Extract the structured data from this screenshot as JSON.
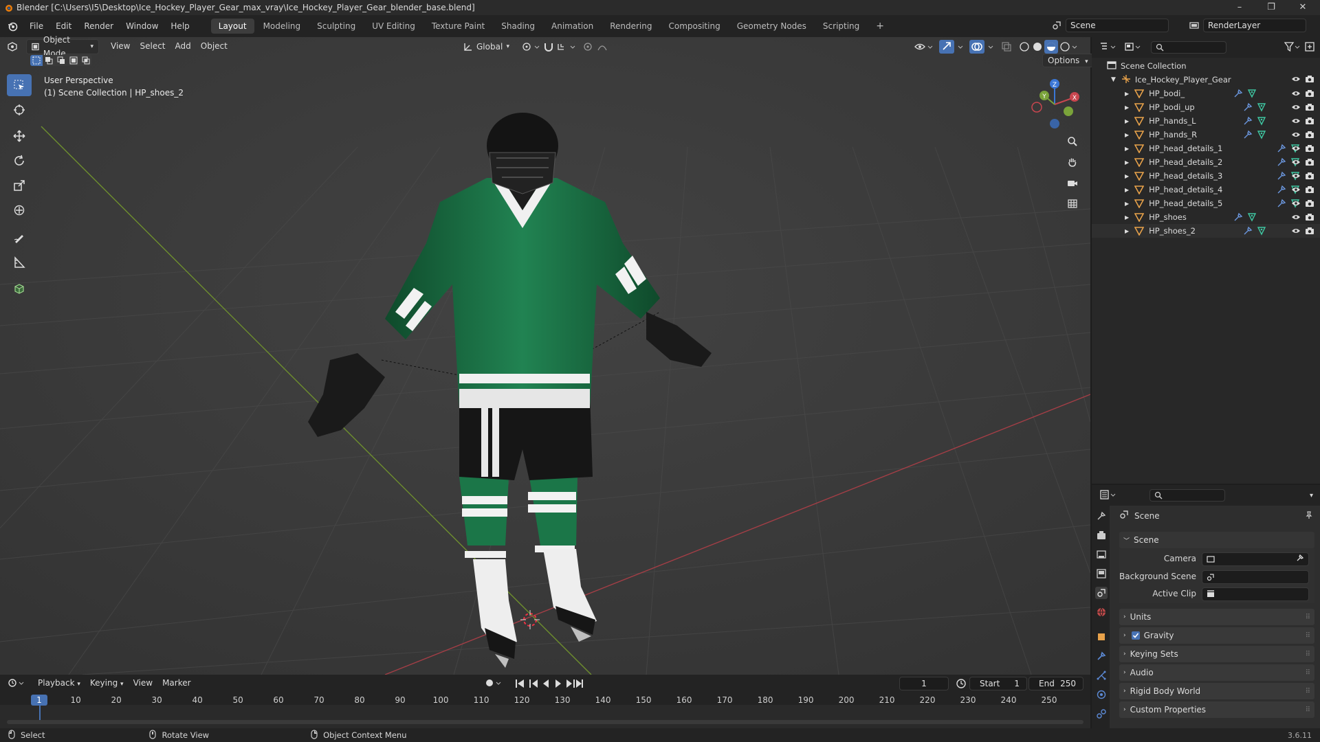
{
  "window": {
    "title": "Blender [C:\\Users\\I5\\Desktop\\Ice_Hockey_Player_Gear_max_vray\\Ice_Hockey_Player_Gear_blender_base.blend]",
    "minimize": "–",
    "maximize": "❐",
    "close": "✕"
  },
  "menu": [
    "File",
    "Edit",
    "Render",
    "Window",
    "Help"
  ],
  "workspaces": [
    "Layout",
    "Modeling",
    "Sculpting",
    "UV Editing",
    "Texture Paint",
    "Shading",
    "Animation",
    "Rendering",
    "Compositing",
    "Geometry Nodes",
    "Scripting"
  ],
  "active_workspace": "Layout",
  "add_workspace": "+",
  "scene_field": "Scene",
  "renderlayer_field": "RenderLayer",
  "viewport": {
    "mode": "Object Mode",
    "menus": [
      "View",
      "Select",
      "Add",
      "Object"
    ],
    "transform_orientation": "Global",
    "options_label": "Options",
    "perspective": "User Perspective",
    "collection_info": "(1) Scene Collection | HP_shoes_2",
    "gizmo_axes": [
      "Z",
      "Y",
      "X"
    ]
  },
  "outliner": {
    "scene_collection": "Scene Collection",
    "collection": "Ice_Hockey_Player_Gear",
    "objects": [
      "HP_bodi_",
      "HP_bodi_up",
      "HP_hands_L",
      "HP_hands_R",
      "HP_head_details_1",
      "HP_head_details_2",
      "HP_head_details_3",
      "HP_head_details_4",
      "HP_head_details_5",
      "HP_shoes",
      "HP_shoes_2"
    ]
  },
  "properties": {
    "context": "Scene",
    "panel_title": "Scene",
    "camera_label": "Camera",
    "background_scene_label": "Background Scene",
    "active_clip_label": "Active Clip",
    "sections": [
      "Units",
      "Gravity",
      "Keying Sets",
      "Audio",
      "Rigid Body World",
      "Custom Properties"
    ],
    "gravity_checked": true
  },
  "timeline": {
    "menus": [
      "Playback",
      "Keying",
      "View",
      "Marker"
    ],
    "current_frame": "1",
    "start_label": "Start",
    "start": "1",
    "end_label": "End",
    "end": "250",
    "ticks": [
      "1",
      "10",
      "20",
      "30",
      "40",
      "50",
      "60",
      "70",
      "80",
      "90",
      "100",
      "110",
      "120",
      "130",
      "140",
      "150",
      "160",
      "170",
      "180",
      "190",
      "200",
      "210",
      "220",
      "230",
      "240",
      "250"
    ]
  },
  "status": {
    "select": "Select",
    "rotate": "Rotate View",
    "context_menu": "Object Context Menu",
    "version": "3.6.11"
  },
  "colors": {
    "accent": "#4772b3",
    "jersey_green": "#1f7a4a",
    "x_axis": "#c8464f",
    "y_axis": "#7aa33a",
    "z_axis": "#3b77d6"
  }
}
